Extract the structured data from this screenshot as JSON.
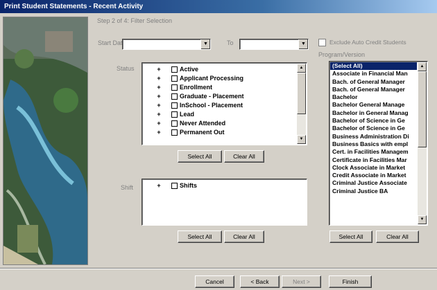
{
  "window": {
    "title": "Print Student Statements - Recent Activity"
  },
  "step": {
    "title": "Step 2 of 4: Filter Selection"
  },
  "start_date": {
    "label": "Start Date",
    "value": ""
  },
  "to_date": {
    "label": "To",
    "value": ""
  },
  "exclude": {
    "label": "Exclude Auto Credit Students",
    "checked": false
  },
  "program": {
    "label": "Program/Version",
    "items": [
      "(Select All)",
      "Associate in Financial Man",
      "Bach. of General Manager",
      "Bach. of General Manager",
      "Bachelor",
      "Bachelor General Manage",
      "Bachelor in General Manag",
      "Bachelor of Science in Ge",
      "Bachelor of Science in Ge",
      "Business Administration Di",
      "Business Basics with empl",
      "Cert. in Facilities Managem",
      "Certificate in Facilities Mar",
      "Clock Associate in Market",
      "Credit Associate in Market",
      "Criminal Justice Associate",
      "Criminal Justice BA"
    ],
    "select_all": "Select All",
    "clear_all": "Clear All"
  },
  "status": {
    "label": "Status",
    "items": [
      "Active",
      "Applicant Processing",
      "Enrollment",
      "Graduate - Placement",
      "InSchool - Placement",
      "Lead",
      "Never Attended",
      "Permanent Out"
    ],
    "select_all": "Select All",
    "clear_all": "Clear All"
  },
  "shift": {
    "label": "Shift",
    "items": [
      "Shifts"
    ],
    "select_all": "Select All",
    "clear_all": "Clear All"
  },
  "footer": {
    "cancel": "Cancel",
    "back": "< Back",
    "next": "Next >",
    "finish": "Finish"
  },
  "icons": {
    "expand": "+",
    "scroll_up": "▲",
    "scroll_down": "▼",
    "dropdown": "▼"
  }
}
